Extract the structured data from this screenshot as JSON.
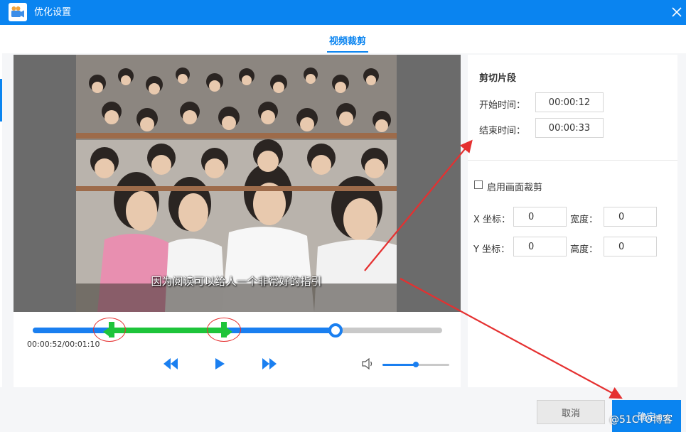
{
  "window": {
    "title": "优化设置",
    "title_icon": "video-camera-icon",
    "close_icon": "close-icon"
  },
  "tabs": [
    {
      "label": "视频裁剪",
      "active": true
    }
  ],
  "video": {
    "subtitle": "因为阅读可以给人一个非常好的指引"
  },
  "player": {
    "timecode": "00:00:52/00:01:10",
    "progress_fraction": 0.74,
    "clip_start_fraction": 0.19,
    "clip_end_fraction": 0.47,
    "volume_fraction": 0.5,
    "buttons": [
      "rewind-icon",
      "play-icon",
      "fast-forward-icon"
    ],
    "volume_icon": "speaker-icon"
  },
  "clip_panel": {
    "title": "剪切片段",
    "start_label": "开始时间：",
    "start_value": "00:00:12",
    "end_label": "结束时间：",
    "end_value": "00:00:33"
  },
  "crop_panel": {
    "enable_label": "启用画面裁剪",
    "enabled": false,
    "x_label": "X 坐标：",
    "x_value": "0",
    "width_label": "宽度：",
    "width_value": "0",
    "y_label": "Y 坐标：",
    "y_value": "0",
    "height_label": "高度：",
    "height_value": "0"
  },
  "footer": {
    "cancel_label": "取消",
    "ok_label": "确定",
    "watermark": "@51CTO博客"
  },
  "colors": {
    "accent": "#0a84f0",
    "clip_green": "#1ec43a",
    "annotation_red": "#e53030"
  }
}
